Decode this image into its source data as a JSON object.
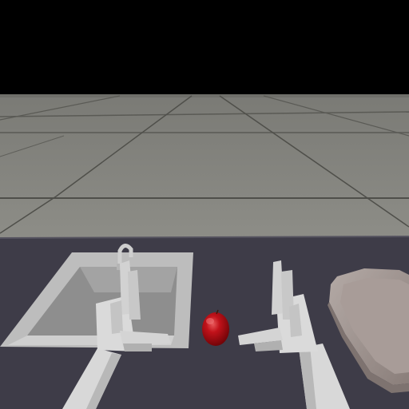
{
  "scene": {
    "description_visible_text": "",
    "colors": {
      "sky": "#000000",
      "floor": "#8c8c86",
      "floor_dark": "#6e6e69",
      "floor_seam": "#4f4f4a",
      "table": "#3e3c48",
      "table_edge": "#4a4856",
      "sink": "#bdbdbd",
      "sink_inner": "#8e8e8e",
      "robot_arm": "#d8d8d8",
      "robot_shadow": "#a9a9a9",
      "apple": "#b0080c",
      "apple_highlight": "#e8585a",
      "plate": "#9c908c",
      "plate_inner": "#a89c98"
    },
    "icons": [
      "left-robot-hand-icon",
      "right-robot-hand-icon",
      "apple-icon",
      "sink-icon",
      "plate-icon",
      "faucet-icon"
    ]
  }
}
